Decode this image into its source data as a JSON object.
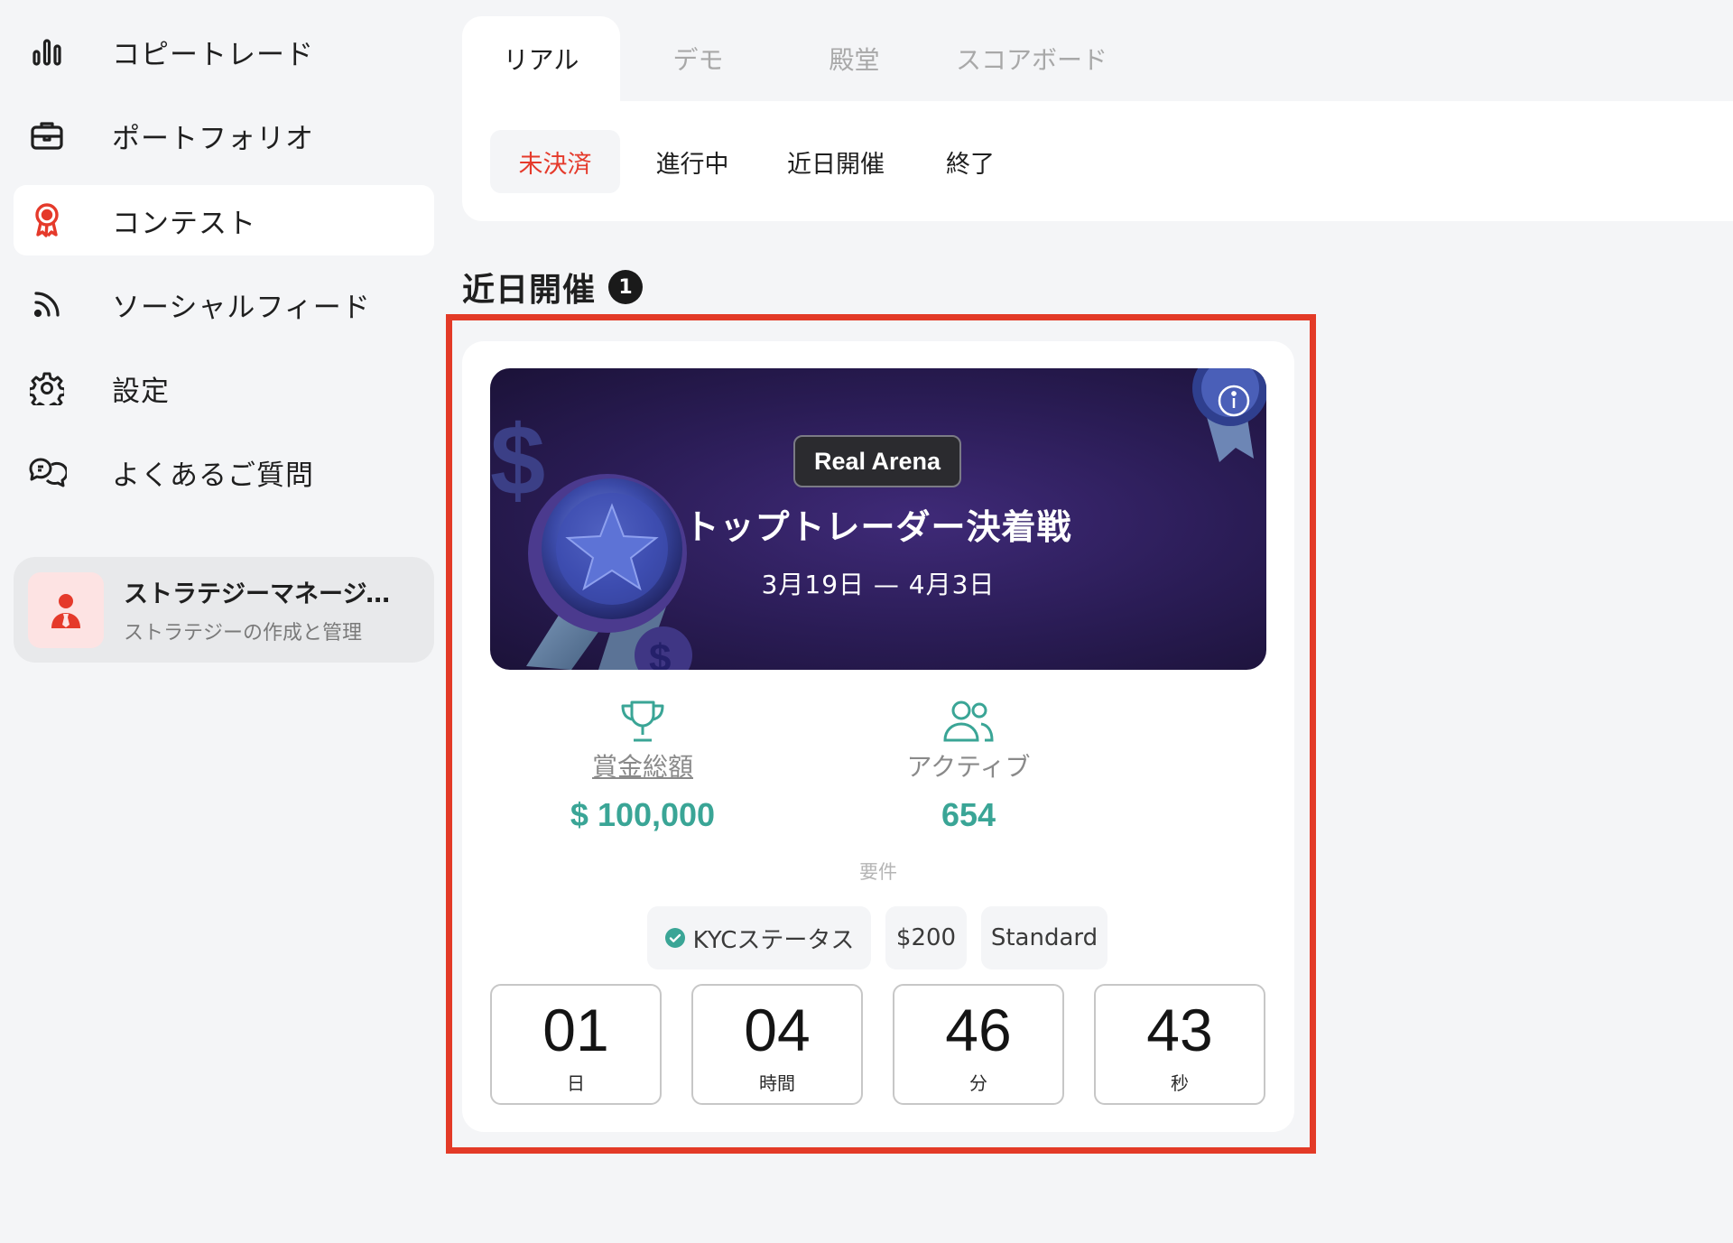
{
  "sidebar": {
    "items": [
      {
        "label": "コピートレード",
        "icon": "bar-chart-icon"
      },
      {
        "label": "ポートフォリオ",
        "icon": "briefcase-icon"
      },
      {
        "label": "コンテスト",
        "icon": "award-ribbon-icon",
        "active": true
      },
      {
        "label": "ソーシャルフィード",
        "icon": "rss-feed-icon"
      },
      {
        "label": "設定",
        "icon": "gear-icon"
      },
      {
        "label": "よくあるご質問",
        "icon": "chat-bubbles-icon"
      }
    ],
    "strategy": {
      "title": "ストラテジーマネージャ...",
      "subtitle": "ストラテジーの作成と管理",
      "icon": "manager-avatar-icon"
    }
  },
  "tabs": {
    "main": [
      {
        "label": "リアル",
        "active": true
      },
      {
        "label": "デモ"
      },
      {
        "label": "殿堂"
      },
      {
        "label": "スコアボード"
      }
    ],
    "sub": [
      {
        "label": "未決済",
        "active": true
      },
      {
        "label": "進行中"
      },
      {
        "label": "近日開催"
      },
      {
        "label": "終了"
      }
    ]
  },
  "section": {
    "title": "近日開催",
    "count": "1"
  },
  "contest": {
    "badge": "Real Arena",
    "title": "トップトレーダー決着戦",
    "dates": "3月19日 — 4月3日",
    "prize": {
      "label": "賞金総額",
      "value": "$ 100,000",
      "icon": "trophy-icon"
    },
    "active": {
      "label": "アクティブ",
      "value": "654",
      "icon": "users-icon"
    },
    "requirements_label": "要件",
    "requirements": [
      "KYCステータス",
      "$200",
      "Standard"
    ],
    "countdown": [
      {
        "value": "01",
        "unit": "日"
      },
      {
        "value": "04",
        "unit": "時間"
      },
      {
        "value": "46",
        "unit": "分"
      },
      {
        "value": "43",
        "unit": "秒"
      }
    ]
  },
  "colors": {
    "accent_red": "#e53a2b",
    "teal": "#3aa596",
    "highlight": "#e33a27",
    "banner": "#2a1c55"
  }
}
